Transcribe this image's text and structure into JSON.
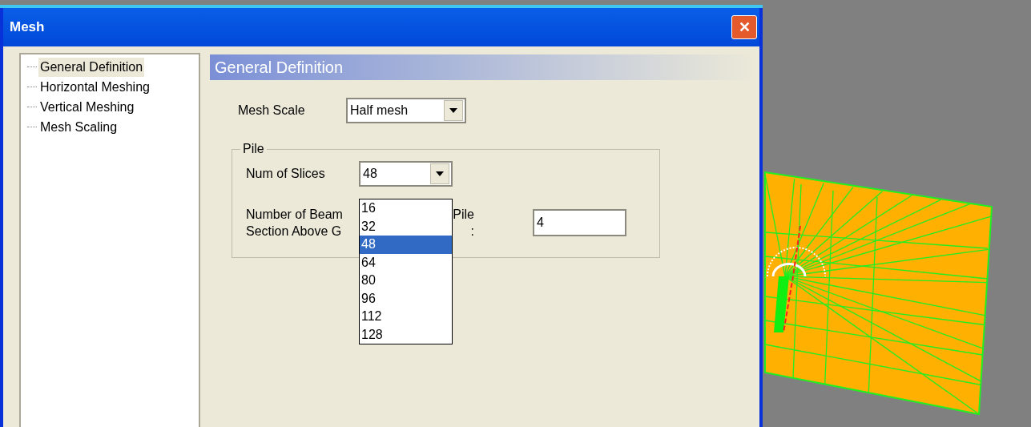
{
  "window": {
    "title": "Mesh",
    "close": "✕"
  },
  "tree": {
    "items": [
      {
        "label": "General Definition",
        "selected": true
      },
      {
        "label": "Horizontal Meshing",
        "selected": false
      },
      {
        "label": "Vertical Meshing",
        "selected": false
      },
      {
        "label": "Mesh Scaling",
        "selected": false
      }
    ]
  },
  "panel": {
    "heading": "General Definition",
    "mesh_scale": {
      "label": "Mesh Scale",
      "value": "Half mesh"
    },
    "pile": {
      "legend": "Pile",
      "slices": {
        "label": "Num of Slices",
        "value": "48",
        "expanded": true,
        "options": [
          {
            "label": "16",
            "selected": false
          },
          {
            "label": "32",
            "selected": false
          },
          {
            "label": "48",
            "selected": true
          },
          {
            "label": "64",
            "selected": false
          },
          {
            "label": "80",
            "selected": false
          },
          {
            "label": "96",
            "selected": false
          },
          {
            "label": "112",
            "selected": false
          },
          {
            "label": "128",
            "selected": false
          }
        ]
      },
      "beams": {
        "label_parts": [
          [
            "Number of Beam",
            "Pile"
          ],
          [
            "Section Above G",
            ":"
          ]
        ],
        "value": "4"
      }
    }
  }
}
